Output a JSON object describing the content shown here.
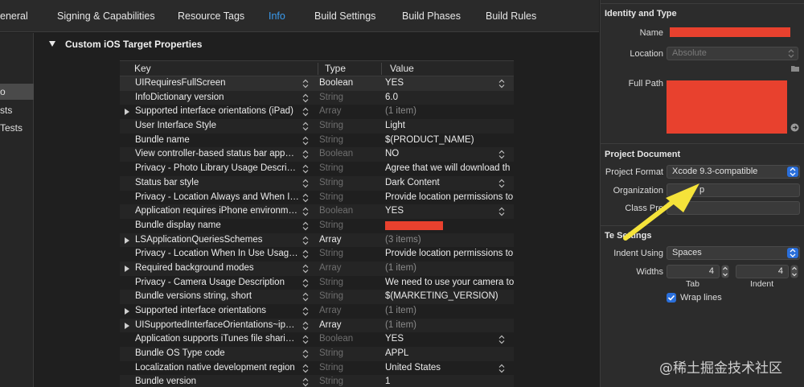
{
  "tabs": [
    {
      "label": "General",
      "visible": "eneral"
    },
    {
      "label": "Signing & Capabilities"
    },
    {
      "label": "Resource Tags"
    },
    {
      "label": "Info",
      "active": true
    },
    {
      "label": "Build Settings"
    },
    {
      "label": "Build Phases"
    },
    {
      "label": "Build Rules"
    }
  ],
  "sidebar": {
    "items": [
      {
        "label": "o",
        "selected": true
      },
      {
        "label": "sts"
      },
      {
        "label": "Tests"
      }
    ]
  },
  "section": {
    "title": "Custom iOS Target Properties"
  },
  "plist": {
    "headers": {
      "key": "Key",
      "type": "Type",
      "value": "Value"
    },
    "rows": [
      {
        "key": "UIRequiresFullScreen",
        "type": "Boolean",
        "type_enabled": true,
        "value": "YES",
        "value_stepper": true,
        "selected": true
      },
      {
        "key": "InfoDictionary version",
        "type": "String",
        "value": "6.0"
      },
      {
        "key": "Supported interface orientations (iPad)",
        "type": "Array",
        "value": "(1 item)",
        "expandable": true,
        "value_dim": true
      },
      {
        "key": "User Interface Style",
        "type": "String",
        "value": "Light"
      },
      {
        "key": "Bundle name",
        "type": "String",
        "value": "$(PRODUCT_NAME)"
      },
      {
        "key": "View controller-based status bar app…",
        "type": "Boolean",
        "value": "NO",
        "value_stepper": true
      },
      {
        "key": "Privacy - Photo Library Usage Descri…",
        "type": "String",
        "value": "Agree that we will download th"
      },
      {
        "key": "Status bar style",
        "type": "String",
        "value": "Dark Content",
        "value_stepper": true
      },
      {
        "key": "Privacy - Location Always and When I…",
        "type": "String",
        "value": "Provide location permissions to"
      },
      {
        "key": "Application requires iPhone environm…",
        "type": "Boolean",
        "value": "YES",
        "value_stepper": true
      },
      {
        "key": "Bundle display name",
        "type": "String",
        "value": "",
        "redacted": true
      },
      {
        "key": "LSApplicationQueriesSchemes",
        "type": "Array",
        "type_enabled": true,
        "value": "(3 items)",
        "expandable": true,
        "value_dim": true
      },
      {
        "key": "Privacy - Location When In Use Usag…",
        "type": "String",
        "value": "Provide location permissions to"
      },
      {
        "key": "Required background modes",
        "type": "Array",
        "value": "(1 item)",
        "expandable": true,
        "value_dim": true
      },
      {
        "key": "Privacy - Camera Usage Description",
        "type": "String",
        "value": "We need to use your camera to"
      },
      {
        "key": "Bundle versions string, short",
        "type": "String",
        "value": "$(MARKETING_VERSION)"
      },
      {
        "key": "Supported interface orientations",
        "type": "Array",
        "value": "(1 item)",
        "expandable": true,
        "value_dim": true
      },
      {
        "key": "UISupportedInterfaceOrientations~ip…",
        "type": "Array",
        "type_enabled": true,
        "value": "(1 item)",
        "expandable": true,
        "value_dim": true
      },
      {
        "key": "Application supports iTunes file shari…",
        "type": "Boolean",
        "value": "YES",
        "value_stepper": true
      },
      {
        "key": "Bundle OS Type code",
        "type": "String",
        "value": "APPL"
      },
      {
        "key": "Localization native development region",
        "type": "String",
        "value": "United States",
        "value_stepper": true
      },
      {
        "key": "Bundle version",
        "type": "String",
        "value": "1"
      }
    ]
  },
  "inspector": {
    "identity": {
      "title": "Identity and Type",
      "name_label": "Name",
      "location_label": "Location",
      "location_value": "Absolute",
      "fullpath_label": "Full Path"
    },
    "project_document": {
      "title": "Project Document",
      "format_label": "Project Format",
      "format_value": "Xcode 9.3-compatible",
      "organization_label": "Organization",
      "organization_value": "p",
      "class_prefix_label": "Class Pre"
    },
    "text_settings": {
      "title": "Te   Settings",
      "indent_label": "Indent Using",
      "indent_value": "Spaces",
      "widths_label": "Widths",
      "tab_value": "4",
      "indent_width_value": "4",
      "tab_caption": "Tab",
      "indent_caption": "Indent",
      "wrap_label": "Wrap lines",
      "wrap_checked": true
    }
  },
  "colors": {
    "accent": "#3a9cf0",
    "redaction": "#e8412e",
    "annotation_arrow": "#f5e33a"
  },
  "watermark": "@稀土掘金技术社区"
}
